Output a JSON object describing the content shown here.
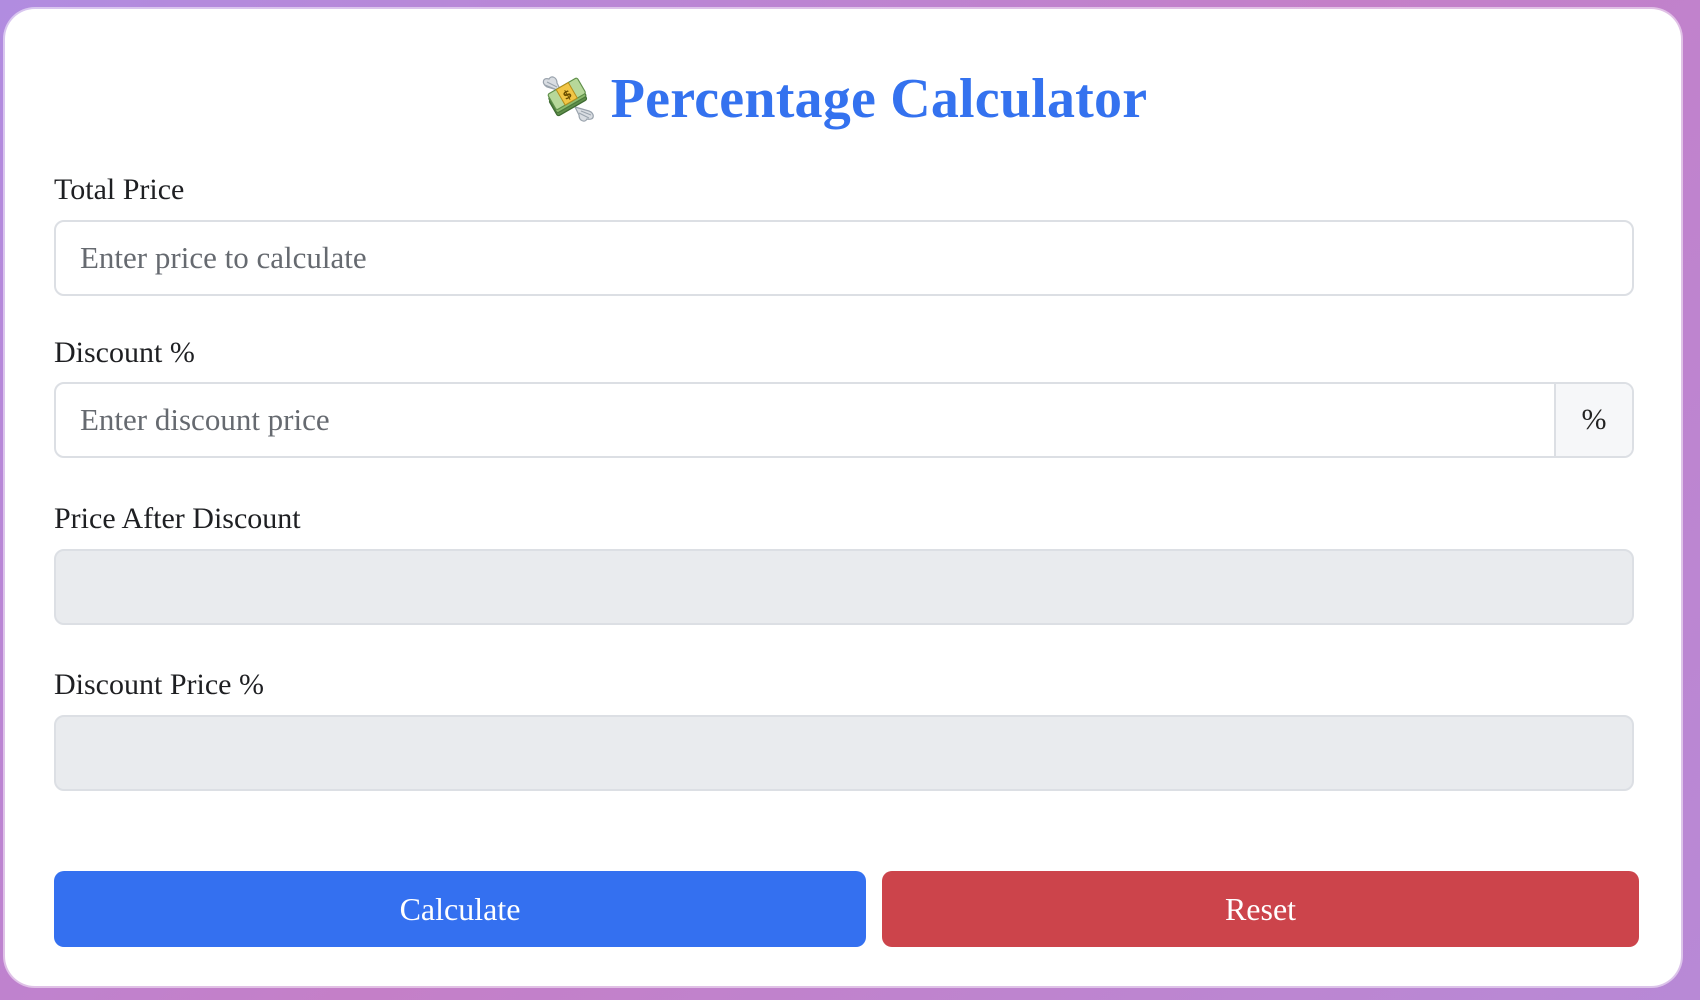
{
  "app": {
    "title": "Percentage Calculator",
    "title_icon": "money-with-wings-icon",
    "accent_color": "#3472ef",
    "danger_color": "#cc444b"
  },
  "form": {
    "total_price": {
      "label": "Total Price",
      "value": "",
      "placeholder": "Enter price to calculate"
    },
    "discount": {
      "label": "Discount %",
      "value": "",
      "placeholder": "Enter discount price",
      "suffix": "%"
    },
    "price_after_discount": {
      "label": "Price After Discount",
      "value": ""
    },
    "discount_price_percent": {
      "label": "Discount Price %",
      "value": ""
    }
  },
  "buttons": {
    "calculate_label": "Calculate",
    "reset_label": "Reset"
  }
}
